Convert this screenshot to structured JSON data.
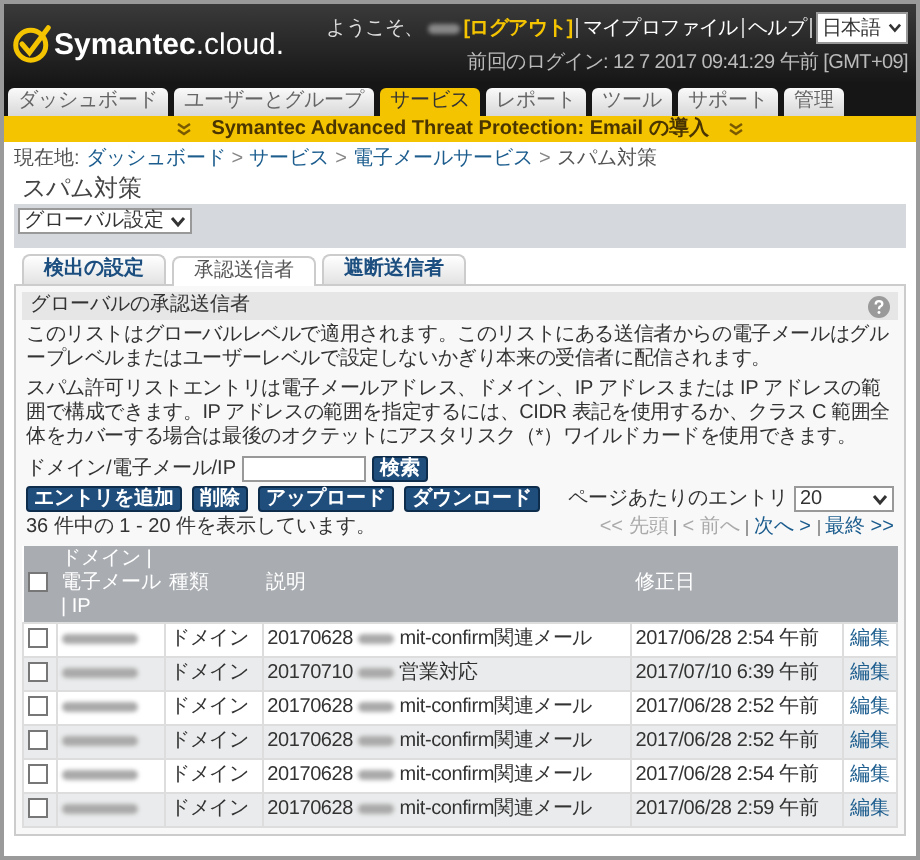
{
  "header": {
    "logo": {
      "name": "Symantec",
      "suffix": ".cloud."
    },
    "welcome": "ようこそ、",
    "logout": "[ログアウト]",
    "links": [
      "マイプロファイル",
      "ヘルプ"
    ],
    "language": "日本語",
    "last_login": "前回のログイン: 12 7 2017 09:41:29 午前 [GMT+09]"
  },
  "nav_tabs": [
    {
      "label": "ダッシュボード",
      "selected": false
    },
    {
      "label": "ユーザーとグループ",
      "selected": false
    },
    {
      "label": "サービス",
      "selected": true
    },
    {
      "label": "レポート",
      "selected": false
    },
    {
      "label": "ツール",
      "selected": false
    },
    {
      "label": "サポート",
      "selected": false
    },
    {
      "label": "管理",
      "selected": false
    }
  ],
  "banner": {
    "text": "Symantec Advanced Threat Protection: Email の導入"
  },
  "breadcrumb": {
    "prefix": "現在地:",
    "links": [
      "ダッシュボード",
      "サービス",
      "電子メールサービス"
    ],
    "separator": ">",
    "current": "スパム対策"
  },
  "page_title": "スパム対策",
  "scope_select": "グローバル設定",
  "tabs": [
    {
      "label": "検出の設定",
      "selected": false
    },
    {
      "label": "承認送信者",
      "selected": true
    },
    {
      "label": "遮断送信者",
      "selected": false
    }
  ],
  "section": {
    "title": "グローバルの承認送信者",
    "paragraphs": [
      "このリストはグローバルレベルで適用されます。このリストにある送信者からの電子メールはグループレベルまたはユーザーレベルで設定しないかぎり本来の受信者に配信されます。",
      "スパム許可リストエントリは電子メールアドレス、ドメイン、IP アドレスまたは IP アドレスの範囲で構成できます。IP アドレスの範囲を指定するには、CIDR 表記を使用するか、クラス C 範囲全体をカバーする場合は最後のオクテットにアスタリスク（*）ワイルドカードを使用できます。"
    ]
  },
  "search": {
    "label": "ドメイン/電子メール/IP",
    "button": "検索"
  },
  "actions": [
    "エントリを追加",
    "削除",
    "アップロード",
    "ダウンロード"
  ],
  "page_size": {
    "label": "ページあたりのエントリ",
    "value": "20"
  },
  "summary": "36 件中の 1 - 20 件を表示しています。",
  "pager": [
    {
      "label": "<< 先頭",
      "disabled": true
    },
    {
      "label": "< 前へ",
      "disabled": true
    },
    {
      "label": "次へ >",
      "disabled": false
    },
    {
      "label": "最終 >>",
      "disabled": false
    }
  ],
  "table": {
    "header_checked": false,
    "columns": [
      "ドメイン | 電子メール | IP",
      "種類",
      "説明",
      "修正日"
    ],
    "rows": [
      {
        "checked": false,
        "type": "ドメイン",
        "description": {
          "date": "20170628",
          "note": "mit-confirm関連メール"
        },
        "modified": "2017/06/28 2:54 午前",
        "action": "編集"
      },
      {
        "checked": false,
        "type": "ドメイン",
        "description": {
          "date": "20170710",
          "note": "営業対応"
        },
        "modified": "2017/07/10 6:39 午前",
        "action": "編集"
      },
      {
        "checked": false,
        "type": "ドメイン",
        "description": {
          "date": "20170628",
          "note": "mit-confirm関連メール"
        },
        "modified": "2017/06/28 2:52 午前",
        "action": "編集"
      },
      {
        "checked": false,
        "type": "ドメイン",
        "description": {
          "date": "20170628",
          "note": "mit-confirm関連メール"
        },
        "modified": "2017/06/28 2:52 午前",
        "action": "編集"
      },
      {
        "checked": false,
        "type": "ドメイン",
        "description": {
          "date": "20170628",
          "note": "mit-confirm関連メール"
        },
        "modified": "2017/06/28 2:54 午前",
        "action": "編集"
      },
      {
        "checked": false,
        "type": "ドメイン",
        "description": {
          "date": "20170628",
          "note": "mit-confirm関連メール"
        },
        "modified": "2017/06/28 2:59 午前",
        "action": "編集"
      }
    ]
  }
}
